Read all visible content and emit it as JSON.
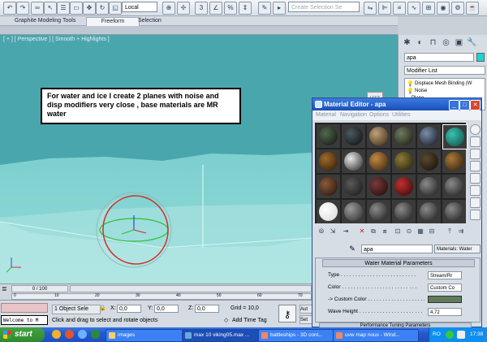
{
  "colors": {
    "accent": "#1a4fb8",
    "viewport": "#4aa6ad",
    "taskbar": "#2459cf",
    "start": "#2e8a2e"
  },
  "toolbar": {
    "coord_system": "Local",
    "named_selection_placeholder": "Create Selection Se",
    "icons": [
      "undo-icon",
      "redo-icon",
      "link-icon",
      "unlink-icon",
      "bind-space-warp-icon",
      "select-icon",
      "select-by-name-icon",
      "rect-select-icon",
      "window-crossing-icon",
      "move-icon",
      "rotate-icon",
      "scale-icon",
      "pivot-icon",
      "snap-3-icon",
      "angle-snap-icon",
      "percent-snap-icon",
      "spinner-snap-icon",
      "named-sets-icon",
      "mirror-icon",
      "align-icon",
      "layers-icon",
      "curve-editor-icon",
      "schematic-icon",
      "material-editor-icon",
      "render-setup-icon",
      "render-frame-icon",
      "render-icon"
    ]
  },
  "ribbon": {
    "tabs": [
      "Graphite Modeling Tools",
      "Freeform",
      "Selection"
    ],
    "active": 1
  },
  "viewport": {
    "label": "[ + ] [ Perspective ] [ Smooth + Highlights ]",
    "annotation": "For water and ice I create 2 planes with noise and disp modifiers very close , base materials are MR water"
  },
  "timeline": {
    "frame": "0 / 100",
    "ticks": [
      "0",
      "10",
      "20",
      "30",
      "40",
      "50",
      "60",
      "70"
    ]
  },
  "status": {
    "selection": "1 Object Sele",
    "x_label": "X:",
    "x_value": "0,0",
    "y_label": "Y:",
    "y_value": "0,0",
    "z_label": "Z:",
    "z_value": "0,0",
    "grid": "Grid = 10,0",
    "prompt": "Click and drag to select and rotate objects",
    "add_time_tag": "Add Time Tag",
    "auto_key": "Aut",
    "set_key": "Set",
    "listener": "Welcome to M"
  },
  "command_panel": {
    "object_name": "apa",
    "modifier_list": "Modifier List",
    "stack": [
      "Displace Mesh Binding (W",
      "Noise",
      "Plane"
    ]
  },
  "material_editor": {
    "title": "Material Editor - apa",
    "menus": [
      "Material",
      "Navigation",
      "Options",
      "Utilities"
    ],
    "material_name": "apa",
    "material_type": "Materials: Water",
    "rollout_title": "Water Material Parameters",
    "params": [
      {
        "label": "Type . . . . . . . . . . . . . . . . . . . . . . . . . .",
        "value": "Stream/Rr"
      },
      {
        "label": "Color . . . . . . . . . . . . . . . . . . . . . . . . . .",
        "value": "Custom Co"
      },
      {
        "label": "-> Custom Color . . . . . . . . . . . . . . . . . . . .",
        "value": ""
      },
      {
        "label": "Wave Height . . . . . . . . . . . . . . . . . . . . . .",
        "value": "4,72"
      }
    ],
    "rollout2_title": "Performance Tuning Parameters"
  },
  "taskbar": {
    "start": "start",
    "tasks": [
      "images",
      "max 10 viking05.max ...",
      "battleships - 3D cont...",
      "uvw map nous - Wind..."
    ],
    "tray_lang": "RO",
    "time": "17:38"
  }
}
